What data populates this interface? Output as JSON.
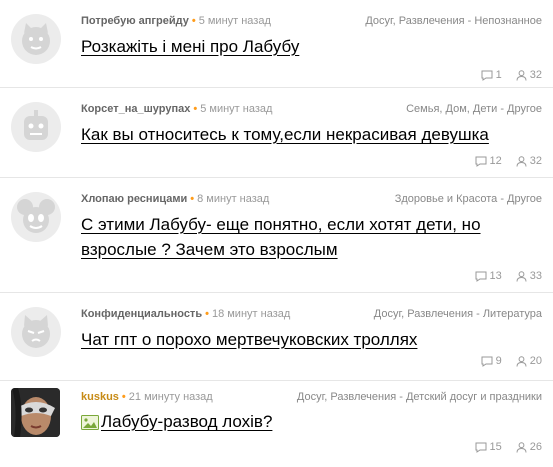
{
  "questions": [
    {
      "author": "Потребую апгрейду",
      "time": "5 минут назад",
      "category": "Досуг, Развлечения - Непознанное",
      "title": "Розкажіть і мені про Лабубу",
      "answers": "1",
      "views": "32"
    },
    {
      "author": "Корсет_на_шурупах",
      "time": "5 минут назад",
      "category": "Семья, Дом, Дети - Другое",
      "title": "Как вы относитесь к тому,если некрасивая девушка",
      "answers": "12",
      "views": "32"
    },
    {
      "author": "Хлопаю ресницами",
      "time": "8 минут назад",
      "category": "Здоровье и Красота - Другое",
      "title": "С этими Лабубу- еще понятно, если хотят дети, но взрослые ? Зачем это взрослым",
      "answers": "13",
      "views": "33"
    },
    {
      "author": "Конфиденциальность",
      "time": "18 минут назад",
      "category": "Досуг, Развлечения - Литература",
      "title": "Чат гпт о порохо мертвечуковских троллях",
      "answers": "9",
      "views": "20"
    },
    {
      "author": "kuskus",
      "time": "21 минуту назад",
      "category": "Досуг, Развлечения - Детский досуг и праздники",
      "title": "Лабубу-развод лохів?",
      "answers": "15",
      "views": "26"
    }
  ],
  "icons": {
    "answers": "comment-icon",
    "views": "person-icon",
    "image": "image-icon"
  },
  "colors": {
    "meta_dot": "#ff9c1a",
    "vip_author": "#c78b16"
  }
}
